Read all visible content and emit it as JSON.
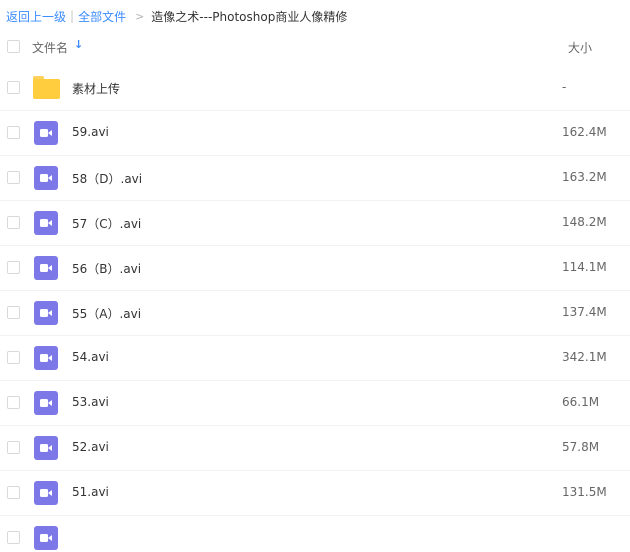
{
  "breadcrumb": {
    "back": "返回上一级",
    "separator": "|",
    "all_files": "全部文件",
    "arrow": ">",
    "current": "造像之术---Photoshop商业人像精修"
  },
  "header": {
    "name_col": "文件名",
    "sort_icon": "arrow-down-icon",
    "size_col": "大小"
  },
  "files": [
    {
      "name": "素材上传",
      "size": "-",
      "type": "folder"
    },
    {
      "name": "59.avi",
      "size": "162.4M",
      "type": "video"
    },
    {
      "name": "58（D）.avi",
      "size": "163.2M",
      "type": "video"
    },
    {
      "name": "57（C）.avi",
      "size": "148.2M",
      "type": "video"
    },
    {
      "name": "56（B）.avi",
      "size": "114.1M",
      "type": "video"
    },
    {
      "name": "55（A）.avi",
      "size": "137.4M",
      "type": "video"
    },
    {
      "name": "54.avi",
      "size": "342.1M",
      "type": "video"
    },
    {
      "name": "53.avi",
      "size": "66.1M",
      "type": "video"
    },
    {
      "name": "52.avi",
      "size": "57.8M",
      "type": "video"
    },
    {
      "name": "51.avi",
      "size": "131.5M",
      "type": "video"
    }
  ],
  "colors": {
    "link": "#3b8cff",
    "folder": "#ffcd3d",
    "video": "#7c78e8"
  }
}
